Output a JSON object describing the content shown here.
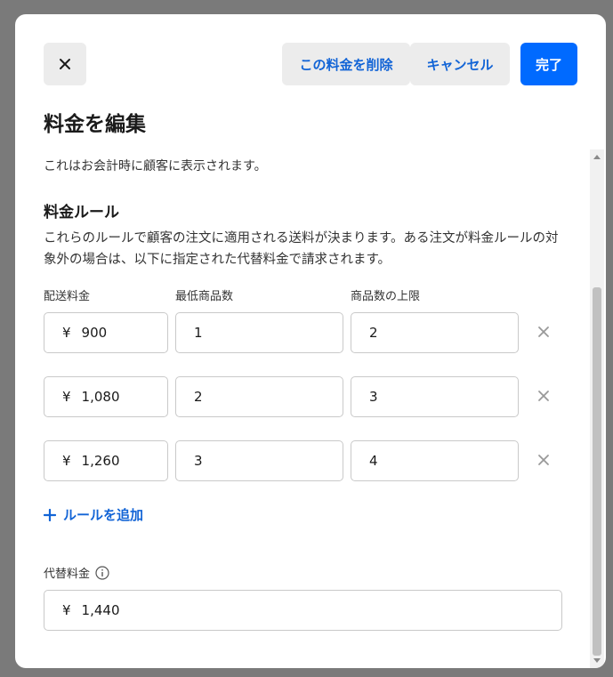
{
  "header": {
    "delete_label": "この料金を削除",
    "cancel_label": "キャンセル",
    "done_label": "完了"
  },
  "title": "料金を編集",
  "description": "これはお会計時に顧客に表示されます。",
  "rules": {
    "heading": "料金ルール",
    "description": "これらのルールで顧客の注文に適用される送料が決まります。ある注文が料金ルールの対象外の場合は、以下に指定された代替料金で請求されます。",
    "columns": {
      "rate": "配送料金",
      "min": "最低商品数",
      "max": "商品数の上限"
    },
    "currency_symbol": "¥",
    "rows": [
      {
        "rate": "900",
        "min": "1",
        "max": "2"
      },
      {
        "rate": "1,080",
        "min": "2",
        "max": "3"
      },
      {
        "rate": "1,260",
        "min": "3",
        "max": "4"
      }
    ],
    "add_label": "ルールを追加"
  },
  "fallback": {
    "label": "代替料金",
    "value": "1,440"
  },
  "icons": {
    "close": "close-icon",
    "remove": "remove-rule-icon",
    "add": "plus-icon",
    "info": "info-icon"
  },
  "colors": {
    "accent": "#006aff",
    "link": "#1264d6",
    "overlay": "#7a7a7a"
  }
}
